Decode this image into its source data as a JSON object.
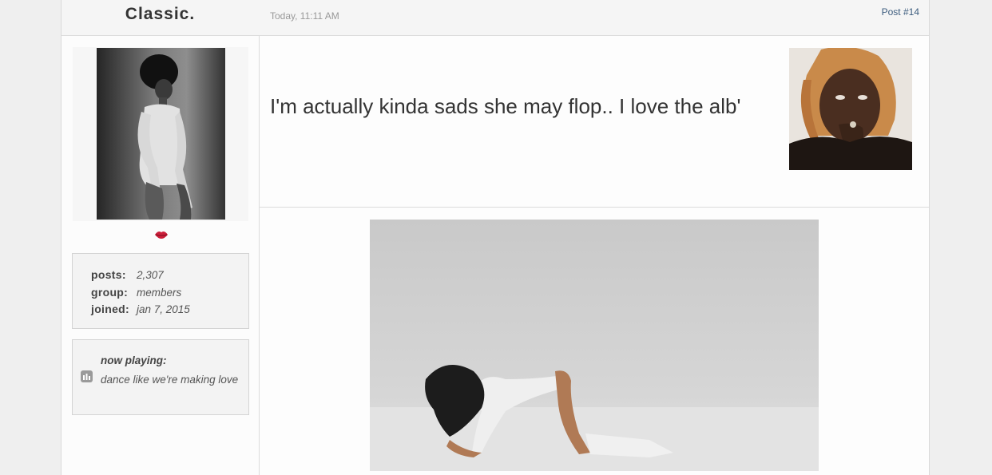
{
  "post": {
    "username": "Classic.",
    "date": "Today, 11:11 AM",
    "number": "Post #14"
  },
  "profile": {
    "avatar_icon": "lips-icon",
    "stats": [
      {
        "label": "posts:",
        "value": "2,307"
      },
      {
        "label": "group:",
        "value": "members"
      },
      {
        "label": "joined:",
        "value": "jan 7, 2015"
      }
    ],
    "now_playing": {
      "icon": "music-icon",
      "title": "now playing:",
      "track": "dance like we're making love"
    }
  },
  "message": {
    "text": "I'm actually kinda sads she may flop.. I love the alb'"
  },
  "colors": {
    "background": "#efefef",
    "panel": "#fcfcfc",
    "link": "#3b5b7d",
    "lips": "#cc1f3a"
  }
}
